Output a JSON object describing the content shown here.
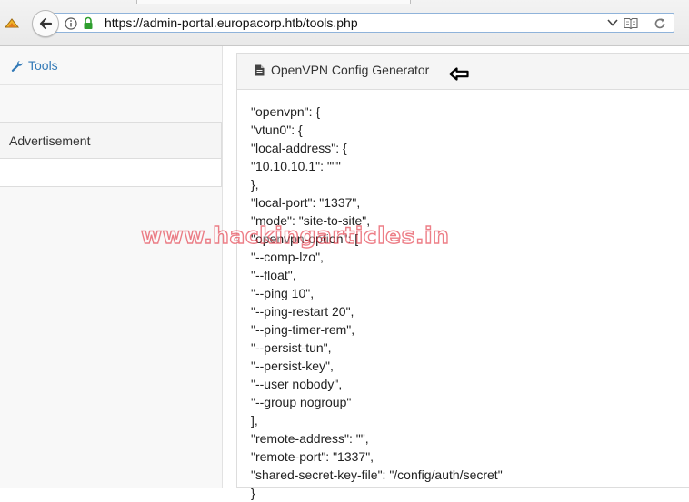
{
  "browser": {
    "url": "https://admin-portal.europacorp.htb/tools.php",
    "colors": {
      "url_focus_border": "#8fb3da",
      "lock_green": "#2e9e2e"
    }
  },
  "sidebar": {
    "nav_tools_label": "Tools",
    "nav_tools_icon": "wrench-icon",
    "ad_heading": "Advertisement",
    "link_color": "#337ab7"
  },
  "main": {
    "panel_title": "OpenVPN Config Generator",
    "panel_icon": "file-icon",
    "code_lines": [
      "\"openvpn\": {",
      "\"vtun0\": {",
      "\"local-address\": {",
      "\"10.10.10.1\": \"\"\"",
      "},",
      "\"local-port\": \"1337\",",
      "\"mode\": \"site-to-site\",",
      "\"openvpn-option\": [",
      "\"--comp-lzo\",",
      "\"--float\",",
      "\"--ping 10\",",
      "\"--ping-restart 20\",",
      "\"--ping-timer-rem\",",
      "\"--persist-tun\",",
      "\"--persist-key\",",
      "\"--user nobody\",",
      "\"--group nogroup\"",
      "],",
      "\"remote-address\": \"\",",
      "\"remote-port\": \"1337\",",
      "\"shared-secret-key-file\": \"/config/auth/secret\"",
      "}"
    ]
  },
  "watermark": {
    "text": "www.hackingarticles.in",
    "color": "#e12837"
  }
}
